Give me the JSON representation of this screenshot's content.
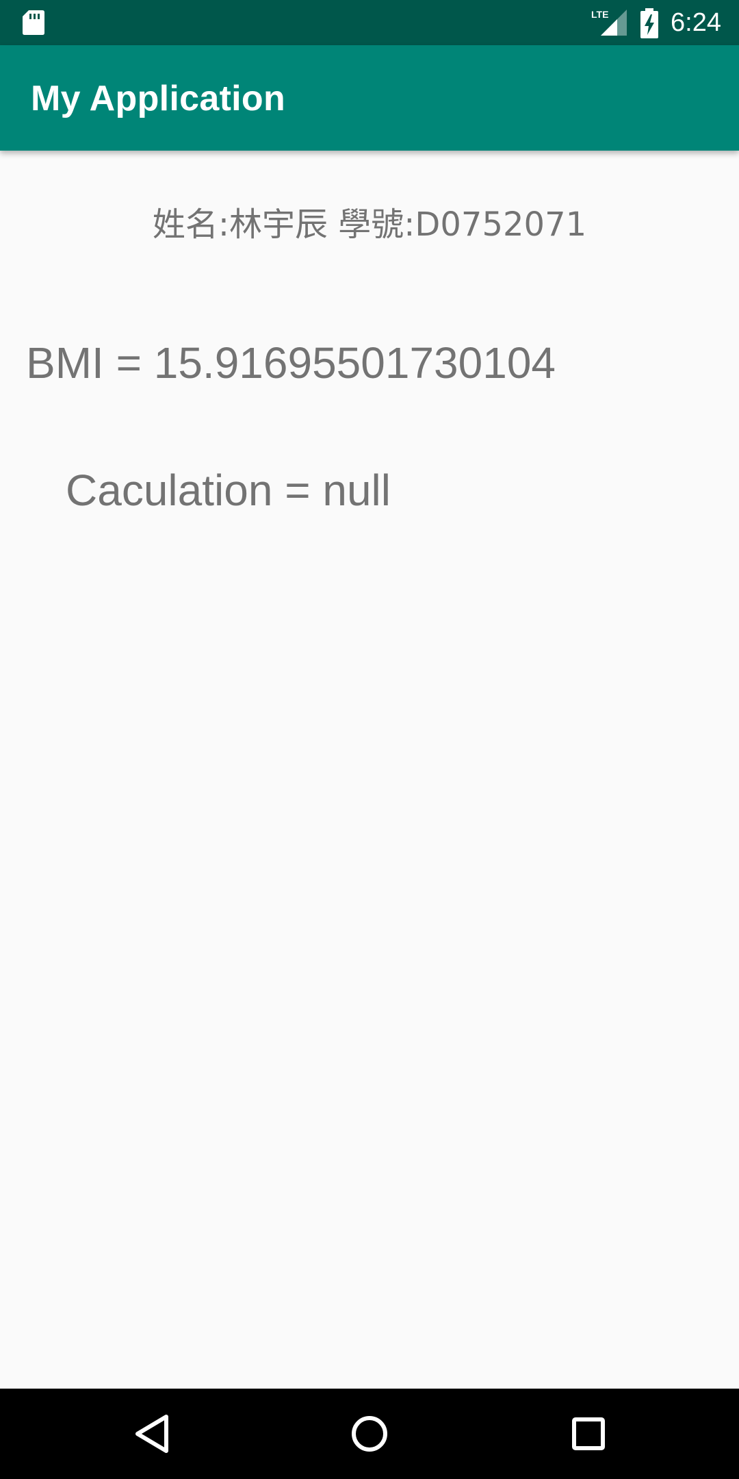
{
  "status_bar": {
    "time": "6:24",
    "network_label": "LTE",
    "icons": [
      "sd-card-icon",
      "lte-signal-icon",
      "battery-charging-icon"
    ]
  },
  "app_bar": {
    "title": "My Application"
  },
  "main": {
    "name_line": "姓名:林宇辰    學號:D0752071",
    "bmi_line": "BMI = 15.91695501730104",
    "calculation_line": "Caculation = null"
  },
  "nav_bar": {
    "icons": [
      "back-icon",
      "home-icon",
      "recent-apps-icon"
    ]
  },
  "colors": {
    "status_bar": "#00574b",
    "app_bar": "#008577",
    "background": "#fafafa",
    "text": "#737373",
    "nav_bar": "#000000"
  }
}
